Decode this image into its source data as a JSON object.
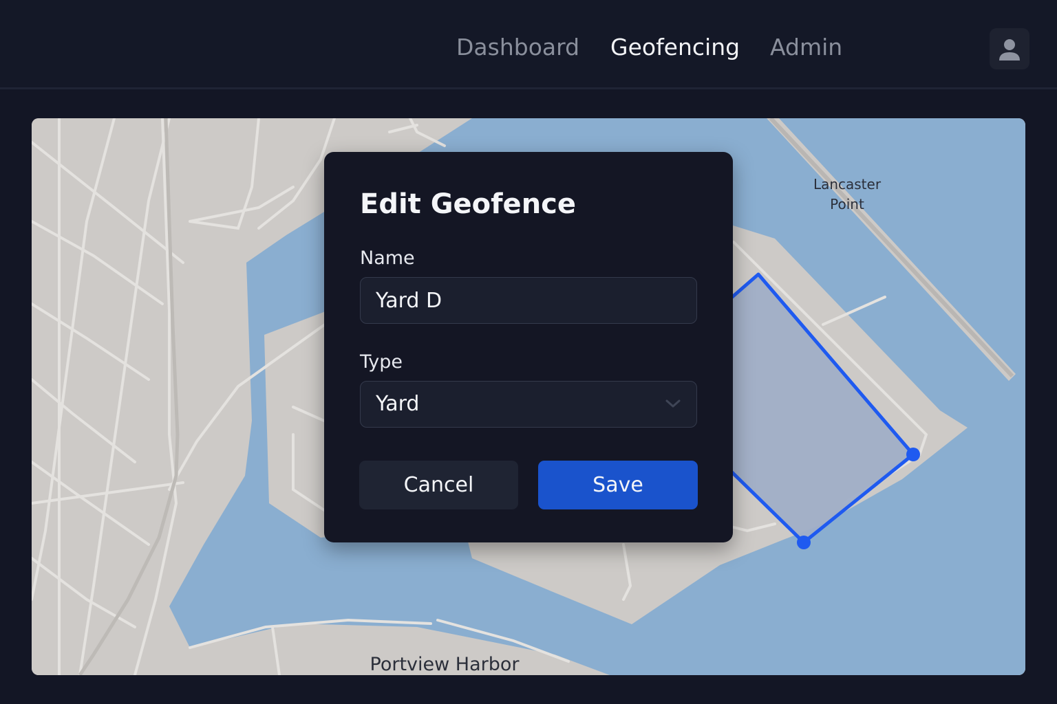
{
  "nav": {
    "items": [
      {
        "label": "Dashboard",
        "active": false
      },
      {
        "label": "Geofencing",
        "active": true
      },
      {
        "label": "Admin",
        "active": false
      }
    ],
    "avatar_icon": "user-icon"
  },
  "map": {
    "labels": {
      "lancaster": "Lancaster\nPoint",
      "portview": "Portview Harbor"
    },
    "colors": {
      "land": "#cdcac7",
      "water": "#8aaed0",
      "road": "#e4e2df",
      "geofence_stroke": "#1f5af0",
      "geofence_fill": "#a0aec7"
    }
  },
  "modal": {
    "title": "Edit Geofence",
    "name_label": "Name",
    "name_value": "Yard D",
    "type_label": "Type",
    "type_value": "Yard",
    "type_icon": "chevron-down-icon",
    "cancel_label": "Cancel",
    "save_label": "Save",
    "colors": {
      "background": "#141624",
      "save": "#1a53cc",
      "cancel": "#1f2433"
    }
  }
}
